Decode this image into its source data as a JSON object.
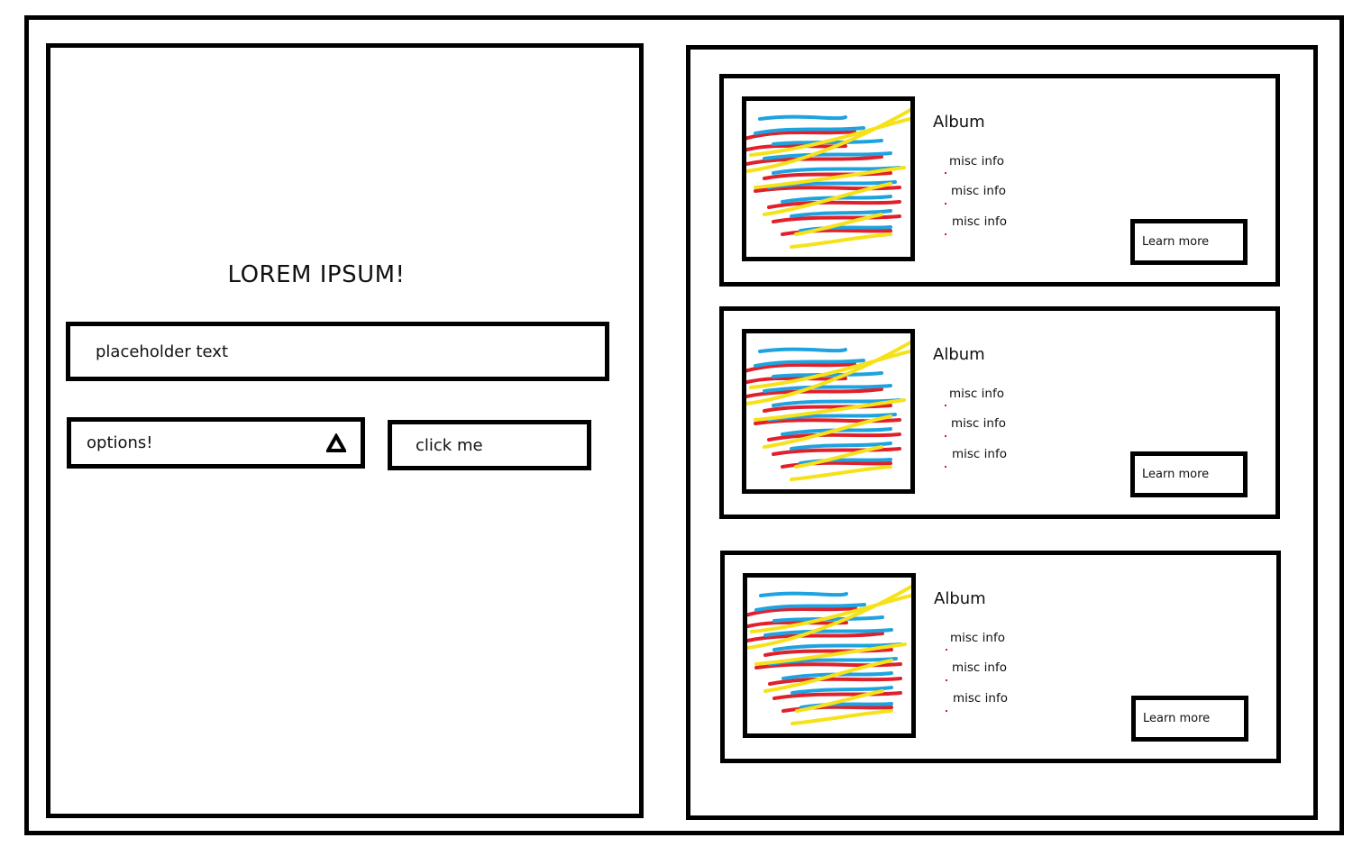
{
  "left": {
    "title": "LOREM IPSUM!",
    "input_placeholder": "placeholder text",
    "select_value": "options!",
    "button_label": "click me"
  },
  "albums": [
    {
      "title": "Album",
      "info": [
        "misc info",
        "misc info",
        "misc info"
      ],
      "button_label": "Learn more"
    },
    {
      "title": "Album",
      "info": [
        "misc info",
        "misc info",
        "misc info"
      ],
      "button_label": "Learn more"
    },
    {
      "title": "Album",
      "info": [
        "misc info",
        "misc info",
        "misc info"
      ],
      "button_label": "Learn more"
    }
  ],
  "colors": {
    "scribble_red": "#e0202a",
    "scribble_blue": "#1ea3e0",
    "scribble_yellow": "#f5e21a",
    "border": "#000000"
  },
  "icons": {
    "select_arrow": "triangle-icon",
    "album_art": "scribble-image"
  }
}
